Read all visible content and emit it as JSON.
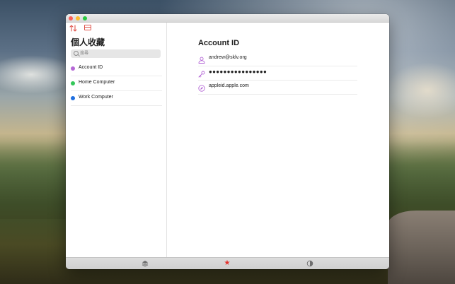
{
  "sidebar": {
    "title": "個人收藏",
    "search_placeholder": "搜尋",
    "items": [
      {
        "label": "Account ID",
        "color": "#b568d6"
      },
      {
        "label": "Home Computer",
        "color": "#34c759"
      },
      {
        "label": "Work Computer",
        "color": "#1f6fe0"
      }
    ]
  },
  "detail": {
    "title": "Account ID",
    "username": "andrew@sklv.org",
    "password": "●●●●●●●●●●●●●●●●",
    "website": "appleid.apple.com"
  },
  "colors": {
    "accent": "#e0544c",
    "field_icon": "#b568d6",
    "favorites_star": "#e5322d"
  },
  "icons": {
    "toolbar": [
      "sort-icon",
      "layout-icon"
    ],
    "fields": [
      "person-icon",
      "key-icon",
      "compass-icon"
    ],
    "bottom_tabs": [
      "layers-icon",
      "star-icon",
      "contrast-icon"
    ]
  }
}
